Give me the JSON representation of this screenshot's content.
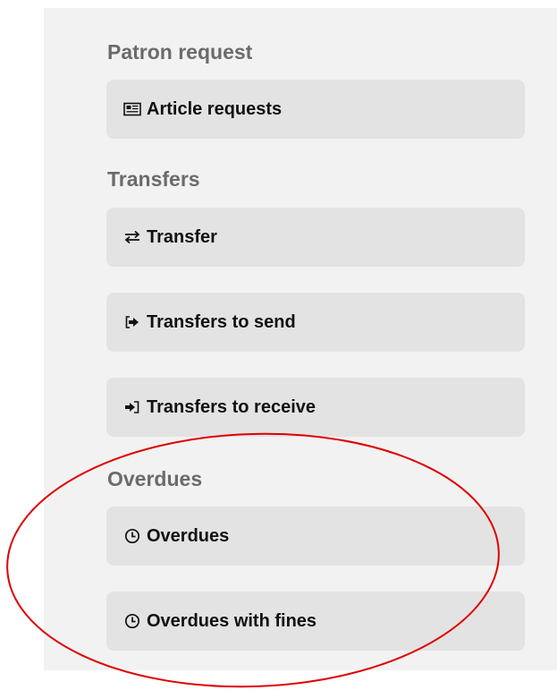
{
  "sections": [
    {
      "heading": "Patron request",
      "items": [
        {
          "label": "Article requests",
          "icon": "newspaper-icon"
        }
      ]
    },
    {
      "heading": "Transfers",
      "items": [
        {
          "label": "Transfer",
          "icon": "exchange-arrows-icon"
        },
        {
          "label": "Transfers to send",
          "icon": "sign-out-icon"
        },
        {
          "label": "Transfers to receive",
          "icon": "sign-in-icon"
        }
      ]
    },
    {
      "heading": "Overdues",
      "items": [
        {
          "label": "Overdues",
          "icon": "clock-icon"
        },
        {
          "label": "Overdues with fines",
          "icon": "clock-icon"
        }
      ]
    }
  ],
  "colors": {
    "panel_background": "#f2f2f2",
    "button_background": "#e3e3e3",
    "heading_text": "#6b6b6b",
    "button_text": "#111111",
    "annotation_ellipse": "#e00000"
  }
}
